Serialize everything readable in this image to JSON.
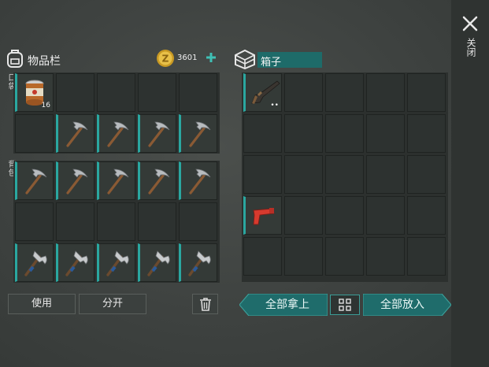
{
  "header": {
    "inventory_title": "物品栏",
    "coins": "3601",
    "container_title": "箱子",
    "close_label": "关闭"
  },
  "side_labels": {
    "pocket": "口袋",
    "backpack": "背包"
  },
  "inventory": {
    "pocket_slots": [
      {
        "item": "canned-food",
        "count": "16"
      },
      {
        "item": null
      },
      {
        "item": null
      },
      {
        "item": null
      },
      {
        "item": null
      },
      {
        "item": null
      },
      {
        "item": "pickaxe"
      },
      {
        "item": "pickaxe"
      },
      {
        "item": "pickaxe"
      },
      {
        "item": "pickaxe"
      }
    ],
    "backpack_slots": [
      {
        "item": "pickaxe"
      },
      {
        "item": "pickaxe"
      },
      {
        "item": "pickaxe"
      },
      {
        "item": "pickaxe"
      },
      {
        "item": "pickaxe"
      },
      {
        "item": null
      },
      {
        "item": null
      },
      {
        "item": null
      },
      {
        "item": null
      },
      {
        "item": null
      },
      {
        "item": "hatchet"
      },
      {
        "item": "hatchet"
      },
      {
        "item": "hatchet"
      },
      {
        "item": "hatchet"
      },
      {
        "item": "hatchet"
      }
    ]
  },
  "container": {
    "slots": [
      {
        "item": "shotgun",
        "count": "••"
      },
      {
        "item": null
      },
      {
        "item": null
      },
      {
        "item": null
      },
      {
        "item": null
      },
      {
        "item": null
      },
      {
        "item": null
      },
      {
        "item": null
      },
      {
        "item": null
      },
      {
        "item": null
      },
      {
        "item": null
      },
      {
        "item": null
      },
      {
        "item": null
      },
      {
        "item": null
      },
      {
        "item": null
      },
      {
        "item": "flare-gun"
      },
      {
        "item": null
      },
      {
        "item": null
      },
      {
        "item": null
      },
      {
        "item": null
      },
      {
        "item": null
      },
      {
        "item": null
      },
      {
        "item": null
      },
      {
        "item": null
      },
      {
        "item": null
      }
    ]
  },
  "buttons": {
    "use": "使用",
    "split": "分开",
    "take_all": "全部拿上",
    "put_all": "全部放入"
  },
  "colors": {
    "accent": "#2aa7a0",
    "teal_button": "#1f6c6b",
    "coin": "#e0b83a"
  }
}
